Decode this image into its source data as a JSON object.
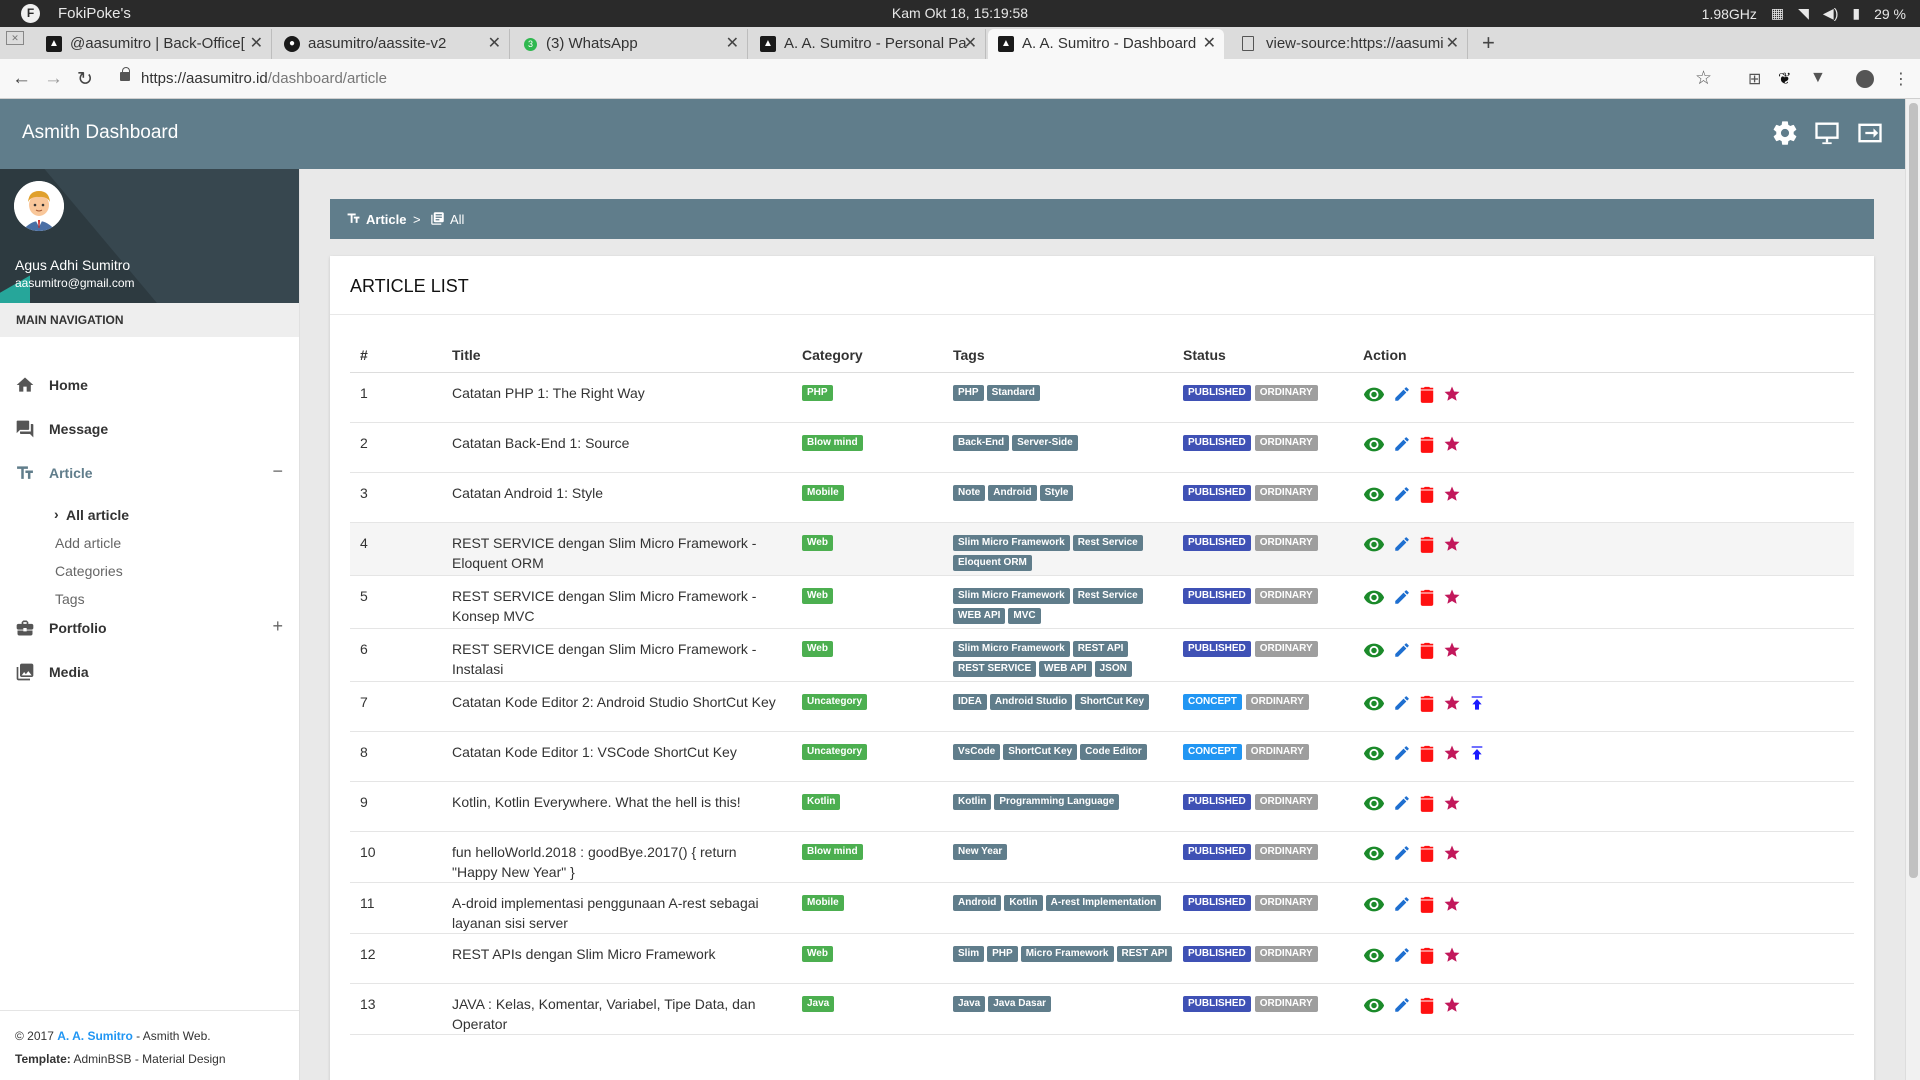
{
  "system": {
    "hostname": "FokiPoke's",
    "clock": "Kam Okt 18, 15:19:58",
    "cpu": "1.98GHz",
    "battery": "29 %"
  },
  "browser": {
    "tabs": [
      {
        "title": "@aasumitro | Back-Office[",
        "icon": "triangle-icon"
      },
      {
        "title": "aasumitro/aassite-v2",
        "icon": "github-icon"
      },
      {
        "title": "(3) WhatsApp",
        "icon": "whatsapp-icon"
      },
      {
        "title": "A. A. Sumitro - Personal Pa",
        "icon": "triangle-icon"
      },
      {
        "title": "A. A. Sumitro - Dashboard",
        "icon": "triangle-icon"
      },
      {
        "title": "view-source:https://aasumi",
        "icon": "document-icon"
      }
    ],
    "url_host": "https://aasumitro.id",
    "url_path": "/dashboard/article"
  },
  "app": {
    "brand": "Asmith Dashboard"
  },
  "user": {
    "name": "Agus Adhi Sumitro",
    "email": "aasumitro@gmail.com"
  },
  "nav": {
    "header": "MAIN NAVIGATION",
    "home": "Home",
    "message": "Message",
    "article": "Article",
    "article_toggle": "−",
    "sub_all": "All article",
    "sub_add": "Add article",
    "sub_categories": "Categories",
    "sub_tags": "Tags",
    "portfolio": "Portfolio",
    "portfolio_toggle": "+",
    "media": "Media"
  },
  "footer": {
    "copy": "© 2017 ",
    "author": "A. A. Sumitro",
    "suffix": " - Asmith Web.",
    "template_label": "Template:",
    "template_value": " AdminBSB - Material Design"
  },
  "breadcrumb": {
    "section": "Article",
    "separator": ">",
    "current": "All"
  },
  "list": {
    "title": "ARTICLE LIST",
    "columns": [
      "#",
      "Title",
      "Category",
      "Tags",
      "Status",
      "Action"
    ],
    "rows": [
      {
        "num": "1",
        "title": "Catatan PHP 1: The Right Way",
        "category": "PHP",
        "tags": [
          "PHP",
          "Standard"
        ],
        "status": "PUBLISHED",
        "type": "ORDINARY",
        "pin": false
      },
      {
        "num": "2",
        "title": "Catatan Back-End 1: Source",
        "category": "Blow mind",
        "tags": [
          "Back-End",
          "Server-Side"
        ],
        "status": "PUBLISHED",
        "type": "ORDINARY",
        "pin": false
      },
      {
        "num": "3",
        "title": "Catatan Android 1: Style",
        "category": "Mobile",
        "tags": [
          "Note",
          "Android",
          "Style"
        ],
        "status": "PUBLISHED",
        "type": "ORDINARY",
        "pin": false
      },
      {
        "num": "4",
        "title": "REST SERVICE dengan Slim Micro Framework - Eloquent ORM",
        "category": "Web",
        "tags": [
          "Slim Micro Framework",
          "Rest Service",
          "Eloquent ORM"
        ],
        "status": "PUBLISHED",
        "type": "ORDINARY",
        "pin": false
      },
      {
        "num": "5",
        "title": "REST SERVICE dengan Slim Micro Framework - Konsep MVC",
        "category": "Web",
        "tags": [
          "Slim Micro Framework",
          "Rest Service",
          "WEB API",
          "MVC"
        ],
        "status": "PUBLISHED",
        "type": "ORDINARY",
        "pin": false
      },
      {
        "num": "6",
        "title": "REST SERVICE dengan Slim Micro Framework - Instalasi",
        "category": "Web",
        "tags": [
          "Slim Micro Framework",
          "REST API",
          "REST SERVICE",
          "WEB API",
          "JSON"
        ],
        "status": "PUBLISHED",
        "type": "ORDINARY",
        "pin": false
      },
      {
        "num": "7",
        "title": "Catatan Kode Editor 2: Android Studio ShortCut Key",
        "category": "Uncategory",
        "tags": [
          "IDEA",
          "Android Studio",
          "ShortCut Key"
        ],
        "status": "CONCEPT",
        "type": "ORDINARY",
        "pin": true
      },
      {
        "num": "8",
        "title": "Catatan Kode Editor 1: VSCode ShortCut Key",
        "category": "Uncategory",
        "tags": [
          "VsCode",
          "ShortCut Key",
          "Code Editor"
        ],
        "status": "CONCEPT",
        "type": "ORDINARY",
        "pin": true
      },
      {
        "num": "9",
        "title": "Kotlin, Kotlin Everywhere. What the hell is this!",
        "category": "Kotlin",
        "tags": [
          "Kotlin",
          "Programming Language"
        ],
        "status": "PUBLISHED",
        "type": "ORDINARY",
        "pin": false
      },
      {
        "num": "10",
        "title": "fun helloWorld.2018 : goodBye.2017() { return \"Happy New Year\" }",
        "category": "Blow mind",
        "tags": [
          "New Year"
        ],
        "status": "PUBLISHED",
        "type": "ORDINARY",
        "pin": false
      },
      {
        "num": "11",
        "title": "A-droid implementasi penggunaan A-rest sebagai layanan sisi server",
        "category": "Mobile",
        "tags": [
          "Android",
          "Kotlin",
          "A-rest Implementation"
        ],
        "status": "PUBLISHED",
        "type": "ORDINARY",
        "pin": false
      },
      {
        "num": "12",
        "title": "REST APIs dengan Slim Micro Framework",
        "category": "Web",
        "tags": [
          "Slim",
          "PHP",
          "Micro Framework",
          "REST API"
        ],
        "status": "PUBLISHED",
        "type": "ORDINARY",
        "pin": false
      },
      {
        "num": "13",
        "title": "JAVA : Kelas, Komentar, Variabel, Tipe Data, dan Operator",
        "category": "Java",
        "tags": [
          "Java",
          "Java Dasar"
        ],
        "status": "PUBLISHED",
        "type": "ORDINARY",
        "pin": false
      }
    ]
  },
  "colors": {
    "header": "#607d8b",
    "category": "#4caf50",
    "published": "#3f51b5",
    "concept": "#2196f3",
    "ordinary": "#9e9e9e",
    "view": "#1b8a2a",
    "edit": "#1e6fd0",
    "delete": "#ff1111",
    "star": "#c2185b",
    "pin": "#1a1aff"
  }
}
